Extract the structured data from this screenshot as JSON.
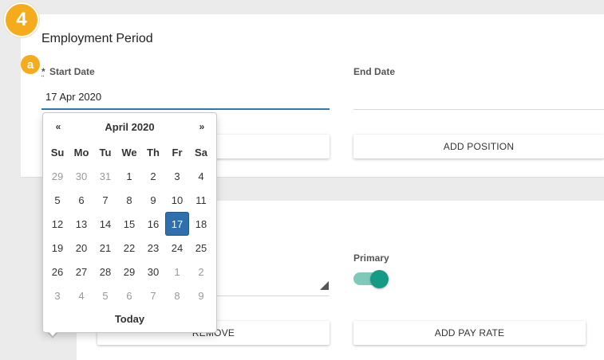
{
  "step_number": "4",
  "sub_step": "a",
  "section_title": "Employment Period",
  "start_date": {
    "required_mark": "*",
    "label": "Start Date",
    "value": "17 Apr 2020"
  },
  "end_date": {
    "label": "End Date",
    "value": ""
  },
  "buttons": {
    "add_position": "ADD POSITION",
    "remove": "REMOVE",
    "add_pay_rate": "ADD PAY RATE"
  },
  "primary": {
    "label": "Primary",
    "on": true
  },
  "datepicker": {
    "prev": "«",
    "next": "»",
    "month_label": "April 2020",
    "weekdays": [
      "Su",
      "Mo",
      "Tu",
      "We",
      "Th",
      "Fr",
      "Sa"
    ],
    "weeks": [
      [
        {
          "d": "29",
          "muted": true
        },
        {
          "d": "30",
          "muted": true
        },
        {
          "d": "31",
          "muted": true
        },
        {
          "d": "1"
        },
        {
          "d": "2"
        },
        {
          "d": "3"
        },
        {
          "d": "4"
        }
      ],
      [
        {
          "d": "5"
        },
        {
          "d": "6"
        },
        {
          "d": "7"
        },
        {
          "d": "8"
        },
        {
          "d": "9"
        },
        {
          "d": "10"
        },
        {
          "d": "11"
        }
      ],
      [
        {
          "d": "12"
        },
        {
          "d": "13"
        },
        {
          "d": "14"
        },
        {
          "d": "15"
        },
        {
          "d": "16"
        },
        {
          "d": "17",
          "selected": true
        },
        {
          "d": "18"
        }
      ],
      [
        {
          "d": "19"
        },
        {
          "d": "20"
        },
        {
          "d": "21"
        },
        {
          "d": "22"
        },
        {
          "d": "23"
        },
        {
          "d": "24"
        },
        {
          "d": "25"
        }
      ],
      [
        {
          "d": "26"
        },
        {
          "d": "27"
        },
        {
          "d": "28"
        },
        {
          "d": "29"
        },
        {
          "d": "30"
        },
        {
          "d": "1",
          "muted": true
        },
        {
          "d": "2",
          "muted": true
        }
      ],
      [
        {
          "d": "3",
          "muted": true
        },
        {
          "d": "4",
          "muted": true
        },
        {
          "d": "5",
          "muted": true
        },
        {
          "d": "6",
          "muted": true
        },
        {
          "d": "7",
          "muted": true
        },
        {
          "d": "8",
          "muted": true
        },
        {
          "d": "9",
          "muted": true
        }
      ]
    ],
    "today_label": "Today"
  },
  "colors": {
    "badge": "#f4ac1c",
    "accent_blue": "#2f78b7",
    "selected_day": "#2f6fae",
    "toggle_track": "#7fc9bb",
    "toggle_knob": "#159a86"
  }
}
